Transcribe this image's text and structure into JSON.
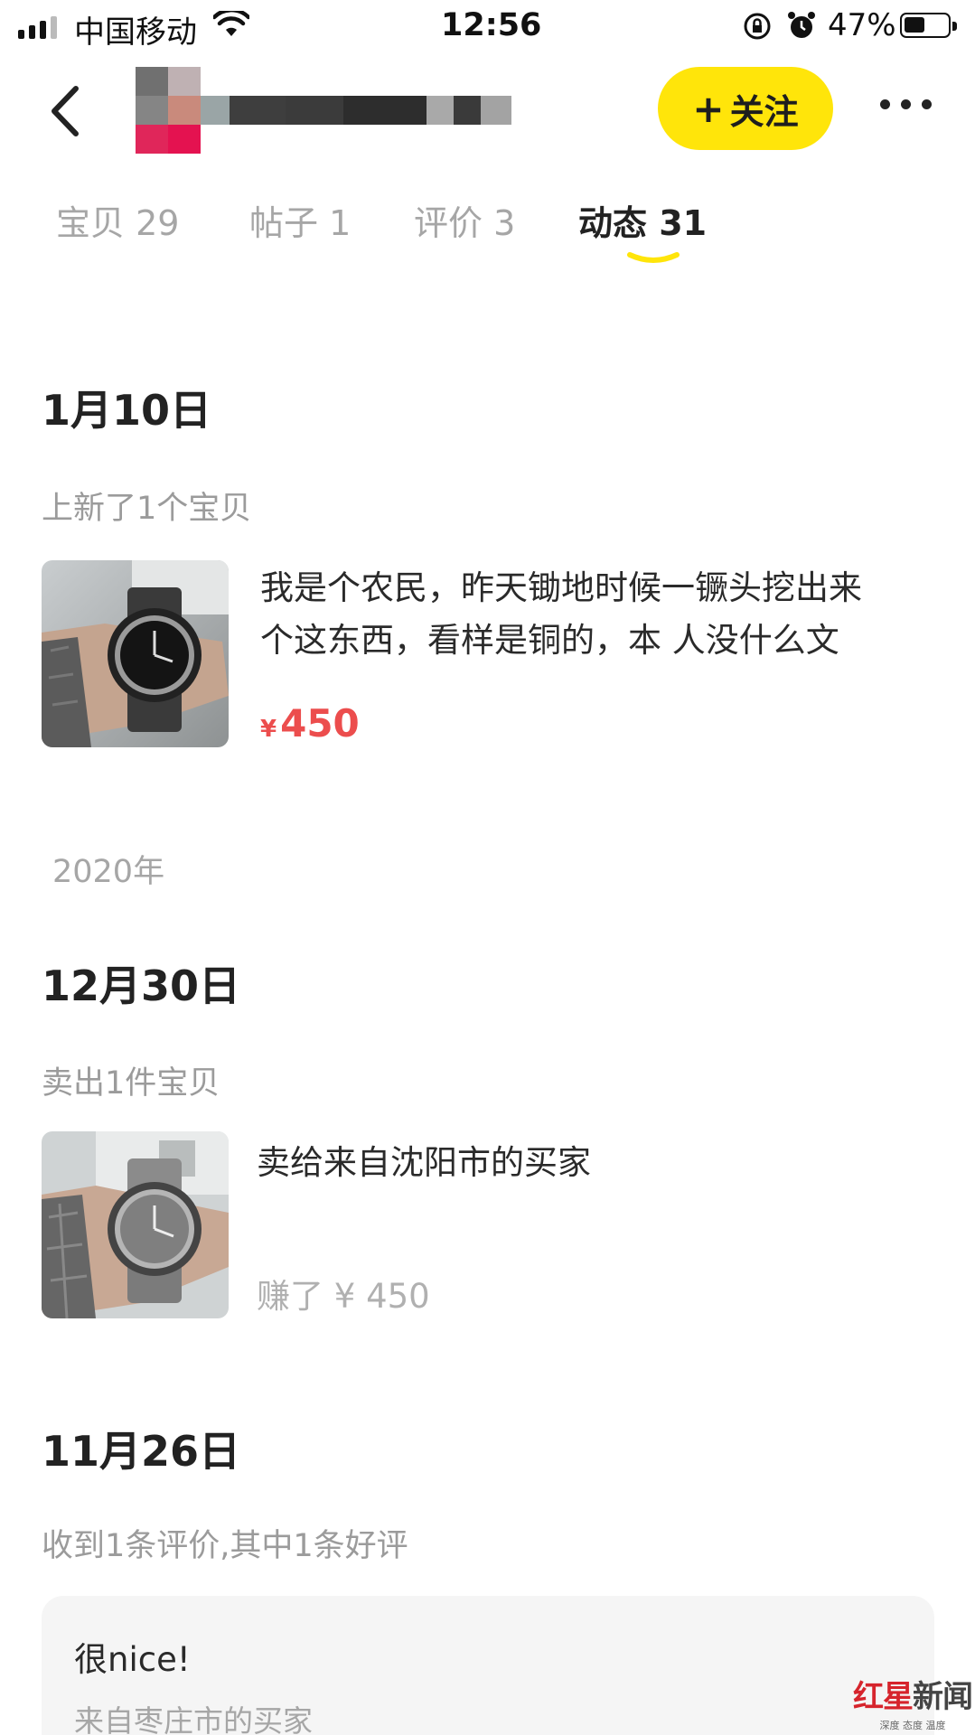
{
  "status_bar": {
    "carrier": "中国移动",
    "time": "12:56",
    "battery_percent": "47%",
    "battery_level": 0.47,
    "icons": [
      "signal-icon",
      "wifi-icon",
      "orientation-lock-icon",
      "alarm-icon",
      "battery-icon"
    ]
  },
  "header": {
    "follow_label": "关注",
    "follow_plus": "+",
    "colors": {
      "follow_bg": "#ffe50a"
    }
  },
  "tabs": [
    {
      "label": "宝贝 29",
      "active": false
    },
    {
      "label": "帖子 1",
      "active": false
    },
    {
      "label": "评价 3",
      "active": false
    },
    {
      "label": "动态 31",
      "active": true
    }
  ],
  "feed": {
    "group1": {
      "date": "1月10日",
      "subtitle": "上新了1个宝贝",
      "desc_line1": "我是个农民，昨天锄地时候一镢头挖出来",
      "desc_line2": "个这东西，看样是铜的，本 人没什么文",
      "price_symbol": "¥",
      "price_value": "450"
    },
    "year": "2020年",
    "group2": {
      "date": "12月30日",
      "subtitle": "卖出1件宝贝",
      "desc": "卖给来自沈阳市的买家",
      "earned": "赚了 ¥ 450"
    },
    "group3": {
      "date": "11月26日",
      "subtitle": "收到1条评价,其中1条好评",
      "review_text": "很nice!",
      "review_from": "来自枣庄市的买家"
    }
  },
  "watermark": {
    "title_part1": "红星",
    "title_part2": "新闻",
    "subtitle": "深度 态度 温度"
  },
  "colors": {
    "price": "#ec4d4d",
    "active_tab_underline": "#ffe50a"
  }
}
